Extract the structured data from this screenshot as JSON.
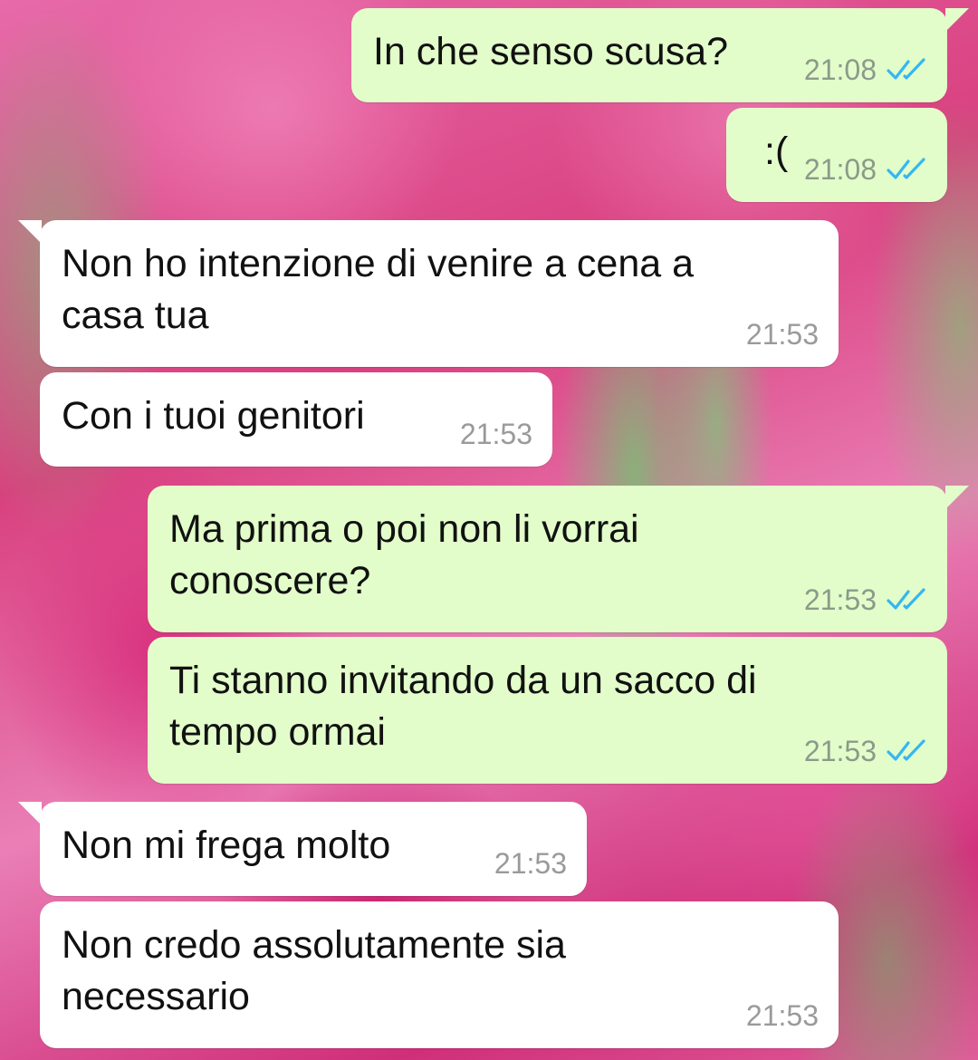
{
  "colors": {
    "outgoing_bubble": "#e2fdca",
    "incoming_bubble": "#ffffff",
    "read_ticks": "#34b7f1",
    "timestamp": "#8b9a8a"
  },
  "messages": [
    {
      "direction": "outgoing",
      "text": "In che senso scusa?",
      "time": "21:08",
      "status_icon": "double-check-read-icon"
    },
    {
      "direction": "outgoing",
      "text": ":(",
      "time": "21:08",
      "status_icon": "double-check-read-icon"
    },
    {
      "direction": "incoming",
      "text": "Non ho intenzione di venire a cena a\ncasa tua",
      "time": "21:53"
    },
    {
      "direction": "incoming",
      "text": "Con i tuoi genitori",
      "time": "21:53"
    },
    {
      "direction": "outgoing",
      "text": "Ma prima o poi non li vorrai\nconoscere?",
      "time": "21:53",
      "status_icon": "double-check-read-icon"
    },
    {
      "direction": "outgoing",
      "text": "Ti stanno invitando da un sacco di\ntempo ormai",
      "time": "21:53",
      "status_icon": "double-check-read-icon"
    },
    {
      "direction": "incoming",
      "text": "Non mi frega molto",
      "time": "21:53"
    },
    {
      "direction": "incoming",
      "text": "Non credo assolutamente sia\nnecessario",
      "time": "21:53"
    }
  ]
}
